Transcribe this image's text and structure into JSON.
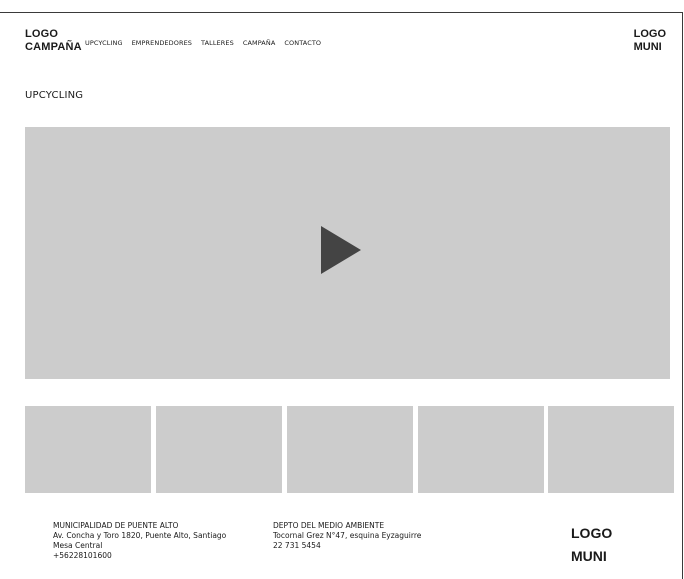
{
  "header": {
    "logo_campana": {
      "line1": "LOGO",
      "line2": "CAMPAÑA"
    },
    "nav": [
      "UPCYCLING",
      "EMPRENDEDORES",
      "TALLERES",
      "CAMPAÑA",
      "CONTACTO"
    ],
    "logo_muni": {
      "line1": "LOGO",
      "line2": "MUNI"
    }
  },
  "main": {
    "title": "UPCYCLING",
    "video": {
      "icon": "play-icon"
    },
    "thumbnails": [
      {},
      {},
      {},
      {},
      {}
    ]
  },
  "footer": {
    "col1": [
      "MUNICIPALIDAD DE PUENTE ALTO",
      "Av. Concha y Toro 1820, Puente Alto, Santiago",
      "Mesa Central",
      "+56228101600"
    ],
    "col2": [
      "DEPTO DEL MEDIO AMBIENTE",
      "Tocornal Grez N°47, esquina Eyzaguirre",
      "22 731 5454"
    ],
    "logo_muni": {
      "line1": "LOGO",
      "line2": "MUNI"
    }
  },
  "colors": {
    "placeholder": "#cccccc",
    "play": "#444444",
    "text": "#1a1a1a"
  }
}
